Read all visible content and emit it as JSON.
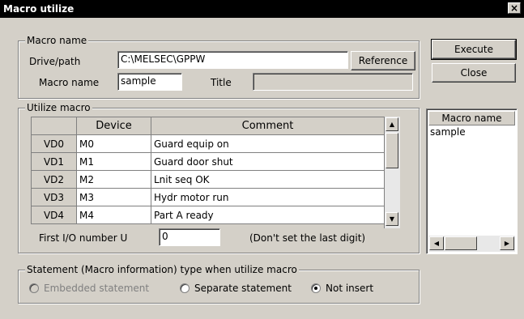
{
  "window": {
    "title": "Macro utilize",
    "close_glyph": "×"
  },
  "macro_name_group": {
    "label": "Macro name",
    "drive_path_label": "Drive/path",
    "drive_path_value": "C:\\MELSEC\\GPPW",
    "reference_label": "Reference",
    "macro_name_label": "Macro name",
    "macro_name_value": "sample",
    "title_label": "Title",
    "title_value": ""
  },
  "buttons": {
    "execute": "Execute",
    "close": "Close"
  },
  "utilize_group": {
    "label": "Utilize macro",
    "columns": [
      "",
      "Device",
      "Comment"
    ],
    "rows": [
      {
        "vd": "VD0",
        "device": "M0",
        "comment": "Guard equip on"
      },
      {
        "vd": "VD1",
        "device": "M1",
        "comment": "Guard door shut"
      },
      {
        "vd": "VD2",
        "device": "M2",
        "comment": "Lnit seq OK"
      },
      {
        "vd": "VD3",
        "device": "M3",
        "comment": "Hydr motor run"
      },
      {
        "vd": "VD4",
        "device": "M4",
        "comment": "Part A ready"
      }
    ],
    "first_io_label": "First I/O number U",
    "first_io_value": "0",
    "first_io_note": "(Don't set the last digit)"
  },
  "macro_list": {
    "header": "Macro name",
    "items": [
      "sample"
    ]
  },
  "statement_group": {
    "label": "Statement (Macro information) type when utilize macro",
    "options": [
      {
        "label": "Embedded statement",
        "selected": false,
        "enabled": false
      },
      {
        "label": "Separate statement",
        "selected": false,
        "enabled": true
      },
      {
        "label": "Not insert",
        "selected": true,
        "enabled": true
      }
    ]
  }
}
